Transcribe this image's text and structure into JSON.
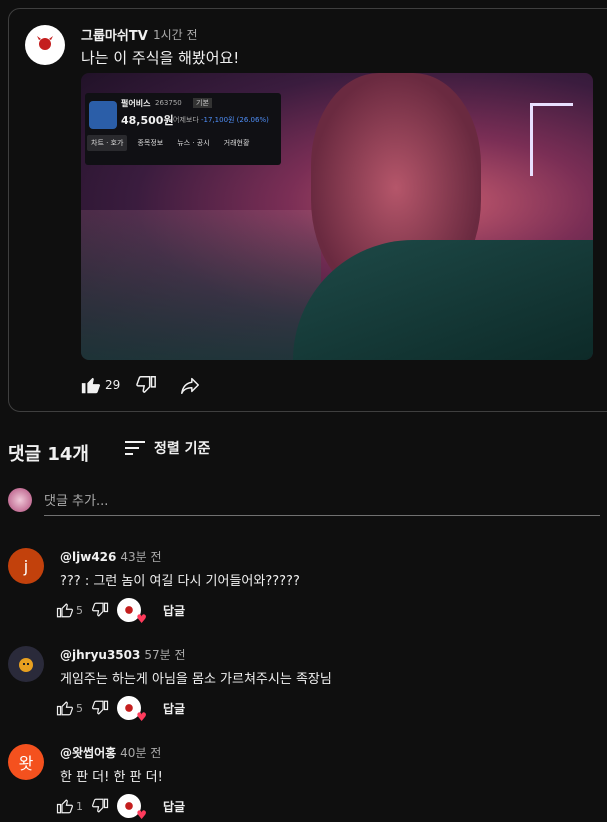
{
  "post": {
    "channel_name": "그룹마쉬TV",
    "time": "1시간 전",
    "text": "나는 이 주식을 해봤어요!",
    "avatar_label": "GROUPMASH TV",
    "like_count": "29",
    "image": {
      "stock_name": "펄어비스",
      "stock_code": "263750",
      "stock_tag": "기본",
      "price": "48,500원",
      "change_label": "어제보다",
      "change": "-17,100원 (26.06%)",
      "tabs": [
        "차트 · 호가",
        "종목정보",
        "뉴스 · 공시",
        "거래현황"
      ]
    }
  },
  "comments_header": {
    "title": "댓글 14개",
    "sort_label": "정렬 기준"
  },
  "add_comment": {
    "placeholder": "댓글 추가..."
  },
  "comments": [
    {
      "author": "@ljw426",
      "time": "43분 전",
      "text": "??? : 그런 놈이 여길 다시 기어들어와?????",
      "likes": "5",
      "avatar_letter": "j",
      "avatar_color": "#c2410c",
      "reply_label": "답글"
    },
    {
      "author": "@jhryu3503",
      "time": "57분 전",
      "text": "게임주는 하는게 아님을 몸소 가르쳐주시는 족장님",
      "likes": "5",
      "avatar_letter": "",
      "avatar_color": "#2a2a3a",
      "reply_label": "답글"
    },
    {
      "author": "@왓썹어홍",
      "time": "40분 전",
      "text": "한 판 더! 한 판 더!",
      "likes": "1",
      "avatar_letter": "왓",
      "avatar_color": "#f4511e",
      "reply_label": "답글"
    }
  ],
  "colors": {
    "background": "#0f0f0f",
    "text": "#f1f1f1",
    "secondary_text": "#aaaaaa",
    "heart": "#ff3b5c"
  }
}
